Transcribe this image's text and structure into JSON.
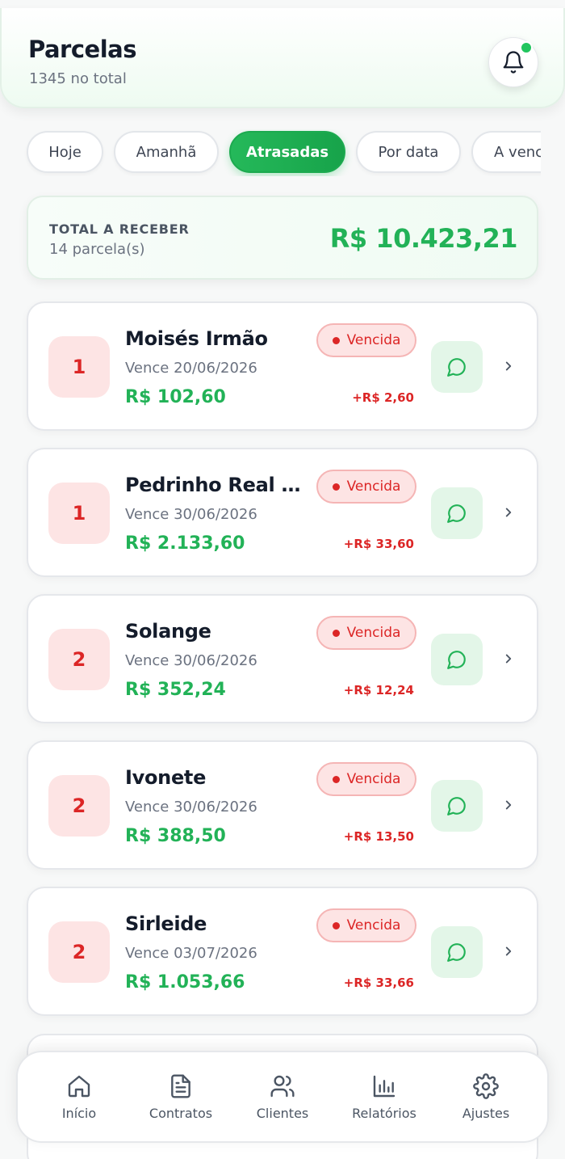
{
  "header": {
    "title": "Parcelas",
    "subtitle": "1345 no total",
    "notification_dot_color": "#22c55e",
    "bell_icon": "bell-icon"
  },
  "tabs": [
    {
      "label": "Hoje",
      "active": false
    },
    {
      "label": "Amanhã",
      "active": false
    },
    {
      "label": "Atrasadas",
      "active": true
    },
    {
      "label": "Por data",
      "active": false
    },
    {
      "label": "A vencer",
      "active": false
    }
  ],
  "summary": {
    "label": "TOTAL A RECEBER",
    "count": "14 parcela(s)",
    "total": "R$ 10.423,21"
  },
  "cards": [
    {
      "number": "1",
      "name": "Moisés Irmão",
      "due": "Vence 20/06/2026",
      "amount": "R$ 102,60",
      "status": "Vencida",
      "fee": "+R$ 2,60"
    },
    {
      "number": "1",
      "name": "Pedrinho Real Correia",
      "due": "Vence 30/06/2026",
      "amount": "R$ 2.133,60",
      "status": "Vencida",
      "fee": "+R$ 33,60"
    },
    {
      "number": "2",
      "name": "Solange",
      "due": "Vence 30/06/2026",
      "amount": "R$ 352,24",
      "status": "Vencida",
      "fee": "+R$ 12,24"
    },
    {
      "number": "2",
      "name": "Ivonete",
      "due": "Vence 30/06/2026",
      "amount": "R$ 388,50",
      "status": "Vencida",
      "fee": "+R$ 13,50"
    },
    {
      "number": "2",
      "name": "Sirleide",
      "due": "Vence 03/07/2026",
      "amount": "R$ 1.053,66",
      "status": "Vencida",
      "fee": "+R$ 33,66"
    }
  ],
  "nav": [
    {
      "label": "Início",
      "icon": "home-icon"
    },
    {
      "label": "Contratos",
      "icon": "document-icon"
    },
    {
      "label": "Clientes",
      "icon": "users-icon"
    },
    {
      "label": "Relatórios",
      "icon": "bar-chart-icon"
    },
    {
      "label": "Ajustes",
      "icon": "gear-icon"
    }
  ],
  "colors": {
    "accent": "#22b257",
    "danger": "#dc2626",
    "danger_bg": "#fde4e4",
    "chat_bg": "#e3f6e8"
  }
}
